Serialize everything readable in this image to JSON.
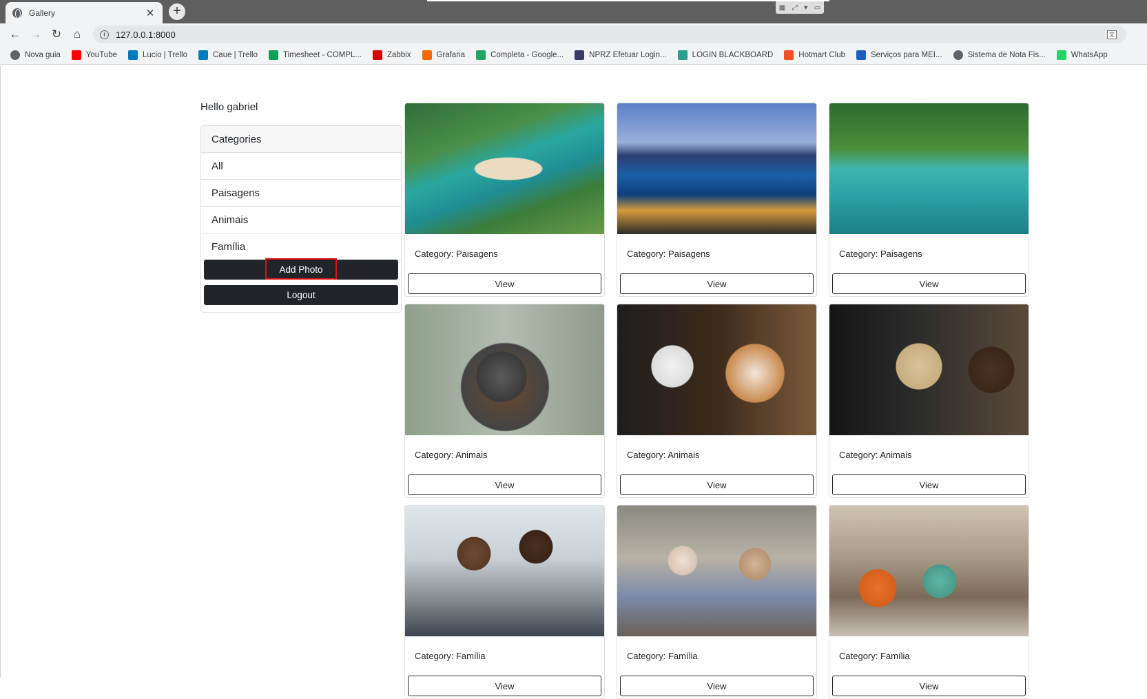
{
  "browser": {
    "tab_title": "Gallery",
    "tab_close": "✕",
    "new_tab": "+",
    "url": "127.0.0.1:8000",
    "bookmarks": [
      {
        "label": "Nova guia",
        "icon": "globe-icon",
        "color": "#5f6368"
      },
      {
        "label": "YouTube",
        "icon": "youtube-icon",
        "color": "#ff0000"
      },
      {
        "label": "Lucio | Trello",
        "icon": "trello-icon",
        "color": "#0079bf"
      },
      {
        "label": "Caue | Trello",
        "icon": "trello-icon",
        "color": "#0079bf"
      },
      {
        "label": "Timesheet - COMPL...",
        "icon": "sheets-icon",
        "color": "#0f9d58"
      },
      {
        "label": "Zabbix",
        "icon": "zabbix-icon",
        "color": "#d40000"
      },
      {
        "label": "Grafana",
        "icon": "grafana-icon",
        "color": "#f46800"
      },
      {
        "label": "Completa - Google...",
        "icon": "drive-icon",
        "color": "#1fa463"
      },
      {
        "label": "NPRZ Efetuar Login...",
        "icon": "nprz-icon",
        "color": "#3a3a6a"
      },
      {
        "label": "LOGIN BLACKBOARD",
        "icon": "blackboard-icon",
        "color": "#2a9d8f"
      },
      {
        "label": "Hotmart Club",
        "icon": "hotmart-icon",
        "color": "#f04e23"
      },
      {
        "label": "Serviços para MEI...",
        "icon": "mei-icon",
        "color": "#1f5fbf"
      },
      {
        "label": "Sistema de Nota Fis...",
        "icon": "globe-icon",
        "color": "#5f6368"
      },
      {
        "label": "WhatsApp",
        "icon": "whatsapp-icon",
        "color": "#25d366"
      }
    ]
  },
  "sidebar": {
    "greeting": "Hello gabriel",
    "categories_header": "Categories",
    "categories": [
      "All",
      "Paisagens",
      "Animais",
      "Família"
    ],
    "add_photo_label": "Add Photo",
    "logout_label": "Logout"
  },
  "gallery": {
    "view_label": "View",
    "photos": [
      {
        "category": "Category: Paisagens",
        "subject": "beach-landscape-photo"
      },
      {
        "category": "Category: Paisagens",
        "subject": "city-beach-night-photo"
      },
      {
        "category": "Category: Paisagens",
        "subject": "underwater-fish-photo"
      },
      {
        "category": "Category: Animais",
        "subject": "cattle-dog-photo"
      },
      {
        "category": "Category: Animais",
        "subject": "two-dogs-selfie-photo"
      },
      {
        "category": "Category: Animais",
        "subject": "labradors-photo"
      },
      {
        "category": "Category: Família",
        "subject": "family-selfie-photo"
      },
      {
        "category": "Category: Família",
        "subject": "grandparents-tablet-photo"
      },
      {
        "category": "Category: Família",
        "subject": "family-sofa-photo"
      }
    ]
  },
  "colors": {
    "button_dark": "#212529",
    "highlight": "#e01010"
  }
}
